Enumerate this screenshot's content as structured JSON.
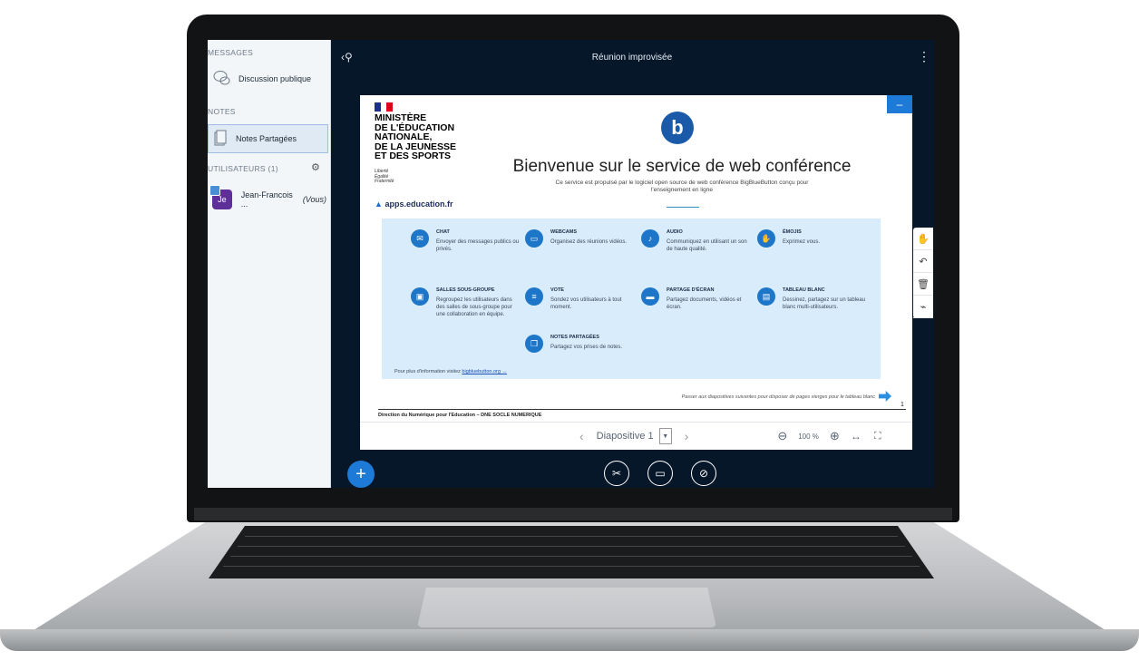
{
  "sidebar": {
    "messages_title": "MESSAGES",
    "public_chat": "Discussion publique",
    "notes_title": "NOTES",
    "shared_notes": "Notes Partagées",
    "users_title": "UTILISATEURS (1)",
    "user": {
      "initials": "Je",
      "name": "Jean-Francois ...",
      "you": "(Vous)"
    }
  },
  "topbar": {
    "title": "Réunion improvisée"
  },
  "slide": {
    "ministry": "MINISTÈRE\nDE L'ÉDUCATION\nNATIONALE,\nDE LA JEUNESSE\nET DES SPORTS",
    "motto": "Liberté\nÉgalité\nFraternité",
    "apps_brand": "apps.education.fr",
    "bbb_logo": "b",
    "title": "Bienvenue sur le service de web conférence",
    "subtitle": "Ce service est propulsé par le logiciel open source de web conférence BigBlueButton conçu pour l'enseignement en ligne",
    "features": [
      {
        "title": "CHAT",
        "desc": "Envoyer des messages publics ou privés.",
        "icon": "chat-icon"
      },
      {
        "title": "WEBCAMS",
        "desc": "Organisez des réunions vidéos.",
        "icon": "webcam-icon"
      },
      {
        "title": "AUDIO",
        "desc": "Communiquez en utilisant un son de haute qualité.",
        "icon": "microphone-icon"
      },
      {
        "title": "ÉMOJIS",
        "desc": "Exprimez vous.",
        "icon": "hand-icon"
      },
      {
        "title": "SALLES SOUS-GROUPE",
        "desc": "Regroupez les utilisateurs dans des salles de sous-groupe pour une collaboration en équipe.",
        "icon": "breakout-icon"
      },
      {
        "title": "VOTE",
        "desc": "Sondez vos utilisateurs à tout moment.",
        "icon": "poll-icon"
      },
      {
        "title": "PARTAGE D'ÉCRAN",
        "desc": "Partagez documents, vidéos et écran.",
        "icon": "screen-share-icon"
      },
      {
        "title": "TABLEAU BLANC",
        "desc": "Dessinez, partagez sur un tableau blanc multi-utilisateurs.",
        "icon": "whiteboard-icon"
      },
      {
        "title": "NOTES PARTAGÉES",
        "desc": "Partagez vos prises de notes.",
        "icon": "notes-icon"
      }
    ],
    "more_info": "Pour plus d'information visitez",
    "more_link": "bigbluebutton.org →",
    "next_info": "Passer aux diapositives suivantes pour disposer de pages vierges pour le tableau blanc",
    "page_number": "1",
    "footer": "Direction du Numérique pour l'Education – DNE SOCLE NUMERIQUE"
  },
  "presentation_toolbar": {
    "slide_label": "Diapositive 1",
    "zoom": "100 %"
  },
  "colors": {
    "accent": "#1d7ad6",
    "screen_bg": "#06172a",
    "features_bg": "#d8ecfb"
  }
}
